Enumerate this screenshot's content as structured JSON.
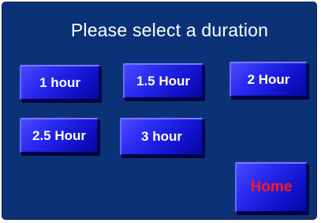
{
  "screen": {
    "title": "Please select a duration"
  },
  "duration_buttons": [
    {
      "label": "1 hour"
    },
    {
      "label": "1.5 Hour"
    },
    {
      "label": "2 Hour"
    },
    {
      "label": "2.5 Hour"
    },
    {
      "label": "3 hour"
    }
  ],
  "home_button": {
    "label": "Home"
  },
  "colors": {
    "panel_background": "#0b3277",
    "button_blue": "#1e1ee6",
    "button_text": "#ffffff",
    "home_text": "#ff1a1a"
  }
}
